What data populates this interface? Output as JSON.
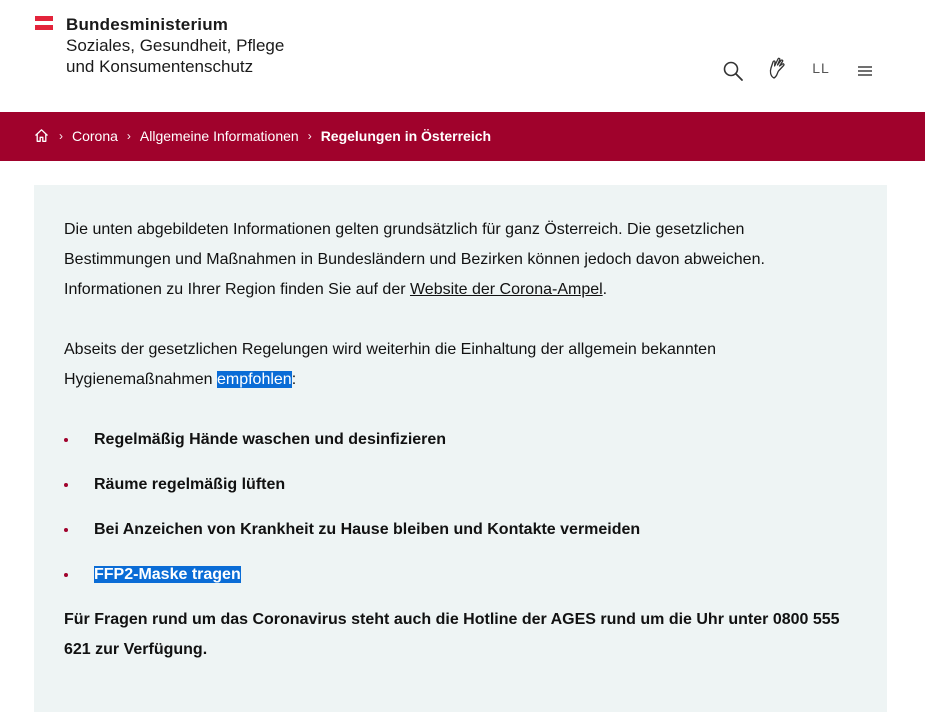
{
  "header": {
    "logo_line1": "Bundesministerium",
    "logo_line2": "Soziales, Gesundheit, Pflege",
    "logo_line3": "und Konsumentenschutz",
    "icons": [
      "search-icon",
      "sign-language-icon",
      "easy-language-icon",
      "menu-icon"
    ],
    "ll_label": "LL"
  },
  "breadcrumb": {
    "items": [
      "Corona",
      "Allgemeine Informationen"
    ],
    "current": "Regelungen in Österreich",
    "separator": "›",
    "bar_color": "#a0022c"
  },
  "content": {
    "para1_text": "Die unten abgebildeten Informationen gelten grundsätzlich für ganz Österreich. Die gesetzlichen Bestimmungen und Maßnahmen in Bundesländern und Bezirken können jedoch davon abweichen. Informationen zu Ihrer Region finden Sie auf der ",
    "para1_link": "Website der Corona-Ampel",
    "para1_end": ".",
    "para2_text": "Abseits der gesetzlichen Regelungen wird weiterhin die Einhaltung der allgemein bekannten Hygienemaßnahmen ",
    "para2_highlight": "empfohlen",
    "para2_end": ":",
    "bullets": [
      "Regelmäßig Hände waschen und desinfizieren",
      "Räume regelmäßig lüften",
      "Bei Anzeichen von Krankheit zu Hause bleiben und Kontakte vermeiden",
      "FFP2-Maske tragen "
    ],
    "hotline": "Für Fragen rund um das Coronavirus steht auch die Hotline der AGES rund um die Uhr unter 0800 555 621 zur Verfügung.",
    "box_color": "#eef4f4",
    "selection_color": "#0a6cd6"
  }
}
